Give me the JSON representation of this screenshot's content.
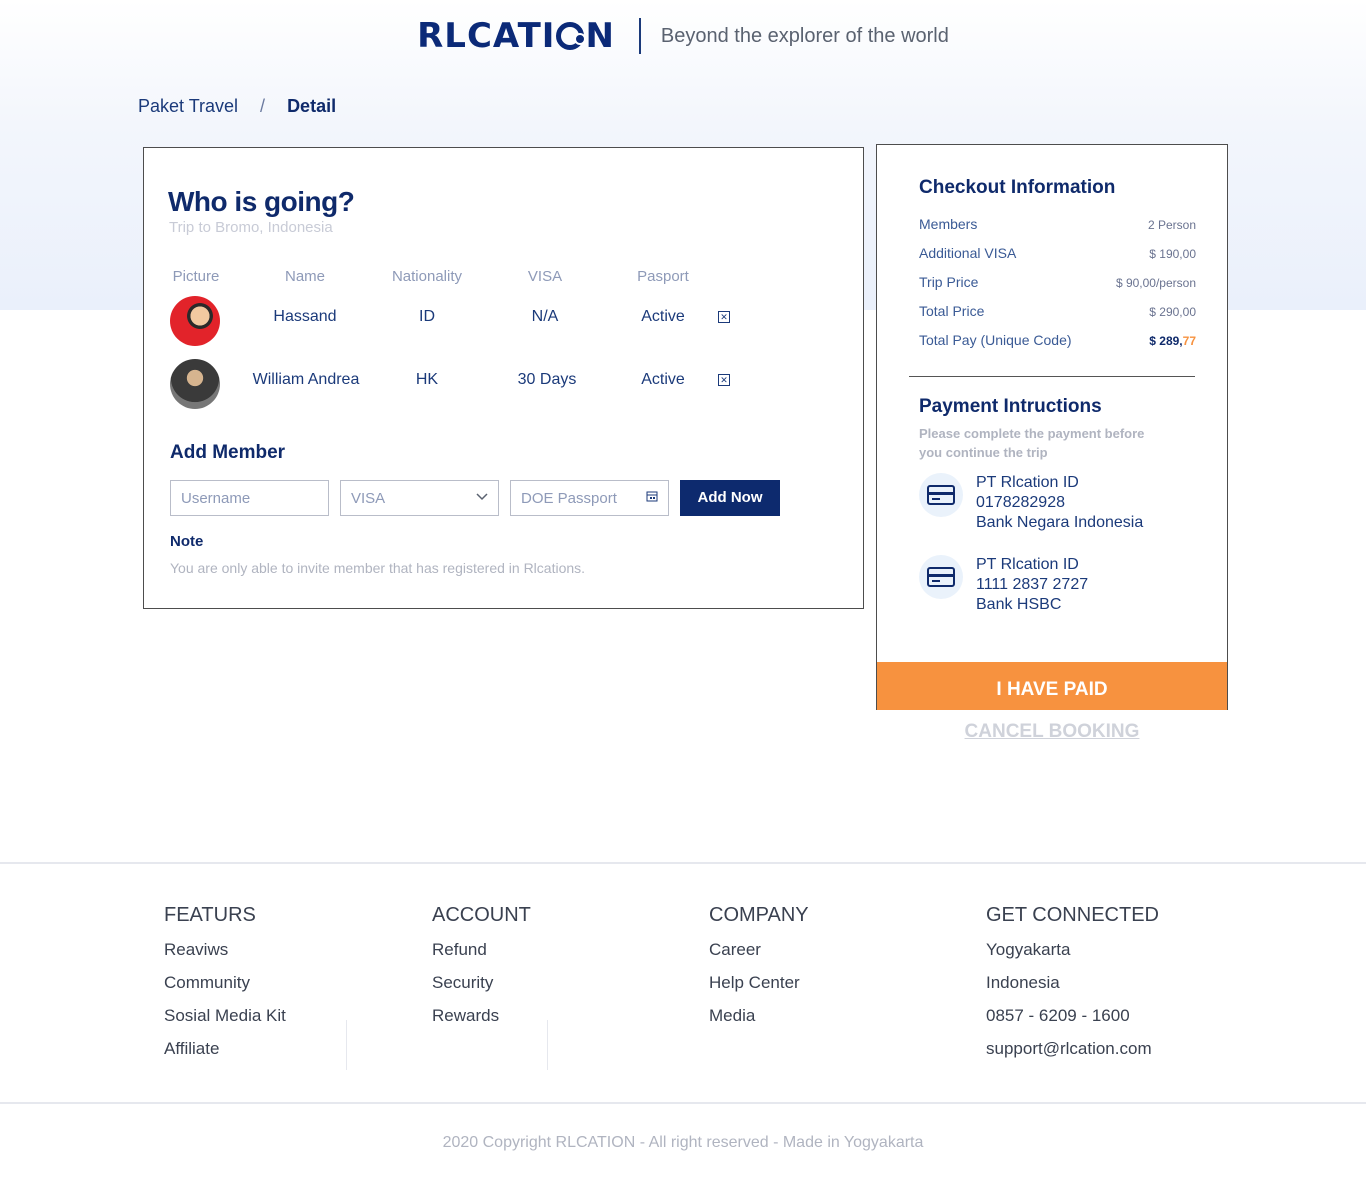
{
  "header": {
    "logo_left": "RLCATI",
    "logo_right": "N",
    "tagline": "Beyond the explorer of the world"
  },
  "breadcrumb": {
    "parent": "Paket Travel",
    "separator": "/",
    "current": "Detail"
  },
  "members_card": {
    "title": "Who is going?",
    "subtitle": "Trip to Bromo, Indonesia",
    "columns": [
      "Picture",
      "Name",
      "Nationality",
      "VISA",
      "Pasport"
    ],
    "members": [
      {
        "name": "Hassand",
        "nationality": "ID",
        "visa": "N/A",
        "passport": "Active",
        "remove_icon": "x-box-icon"
      },
      {
        "name": "William Andrea",
        "nationality": "HK",
        "visa": "30 Days",
        "passport": "Active",
        "remove_icon": "x-box-icon"
      }
    ],
    "add_member_title": "Add Member",
    "username_placeholder": "Username",
    "visa_select_value": "VISA",
    "doe_placeholder": "DOE Passport",
    "add_button": "Add Now",
    "note_title": "Note",
    "note_text": "You are only able to invite member that has registered in Rlcations."
  },
  "checkout": {
    "title": "Checkout Information",
    "rows": [
      {
        "label": "Members",
        "value": "2 Person"
      },
      {
        "label": "Additional VISA",
        "value": "$ 190,00"
      },
      {
        "label": "Trip Price",
        "value": "$ 90,00/person"
      },
      {
        "label": "Total Price",
        "value": "$ 290,00"
      },
      {
        "label": "Total Pay (Unique Code)",
        "value_main": "$ 289,",
        "value_accent": "77"
      }
    ],
    "payment_title": "Payment Intructions",
    "payment_sub": "Please complete the payment before you continue the trip",
    "banks": [
      {
        "company": "PT Rlcation ID",
        "number": "0178282928",
        "bank": "Bank Negara Indonesia",
        "icon": "credit-card-icon"
      },
      {
        "company": "PT Rlcation ID",
        "number": "1111 2837 2727",
        "bank": "Bank HSBC",
        "icon": "credit-card-icon"
      }
    ],
    "paid_button": "I HAVE PAID",
    "cancel_link": "CANCEL BOOKING"
  },
  "footer": {
    "columns": [
      {
        "title": "FEATURS",
        "items": [
          "Reaviws",
          "Community",
          "Sosial Media Kit",
          "Affiliate"
        ]
      },
      {
        "title": "ACCOUNT",
        "items": [
          "Refund",
          "Security",
          "Rewards"
        ]
      },
      {
        "title": "COMPANY",
        "items": [
          "Career",
          "Help Center",
          "Media"
        ]
      },
      {
        "title": "GET CONNECTED",
        "items": [
          "Yogyakarta",
          "Indonesia",
          "0857 - 6209 - 1600",
          "support@rlcation.com"
        ]
      }
    ],
    "copyright": "2020 Copyright RLCATION  - All right reserved - Made in Yogyakarta"
  },
  "colors": {
    "brand_navy": "#0d2a6e",
    "accent_orange": "#f7923f"
  }
}
